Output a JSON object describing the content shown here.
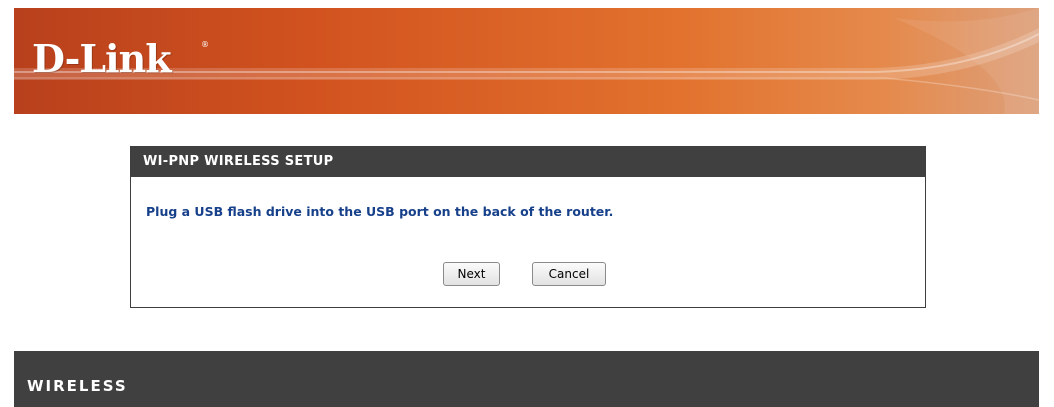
{
  "header": {
    "brand": "D-Link",
    "brand_mark": "®"
  },
  "setup_panel": {
    "title": "WI-PNP WIRELESS SETUP",
    "message": "Plug a USB flash drive into the USB port on the back of the router.",
    "next_label": "Next",
    "cancel_label": "Cancel"
  },
  "footer": {
    "label": "WIRELESS"
  },
  "colors": {
    "header_orange": "#d2531f",
    "panel_title_bg": "#404040",
    "message_blue": "#17408b",
    "footer_bg": "#404040"
  }
}
